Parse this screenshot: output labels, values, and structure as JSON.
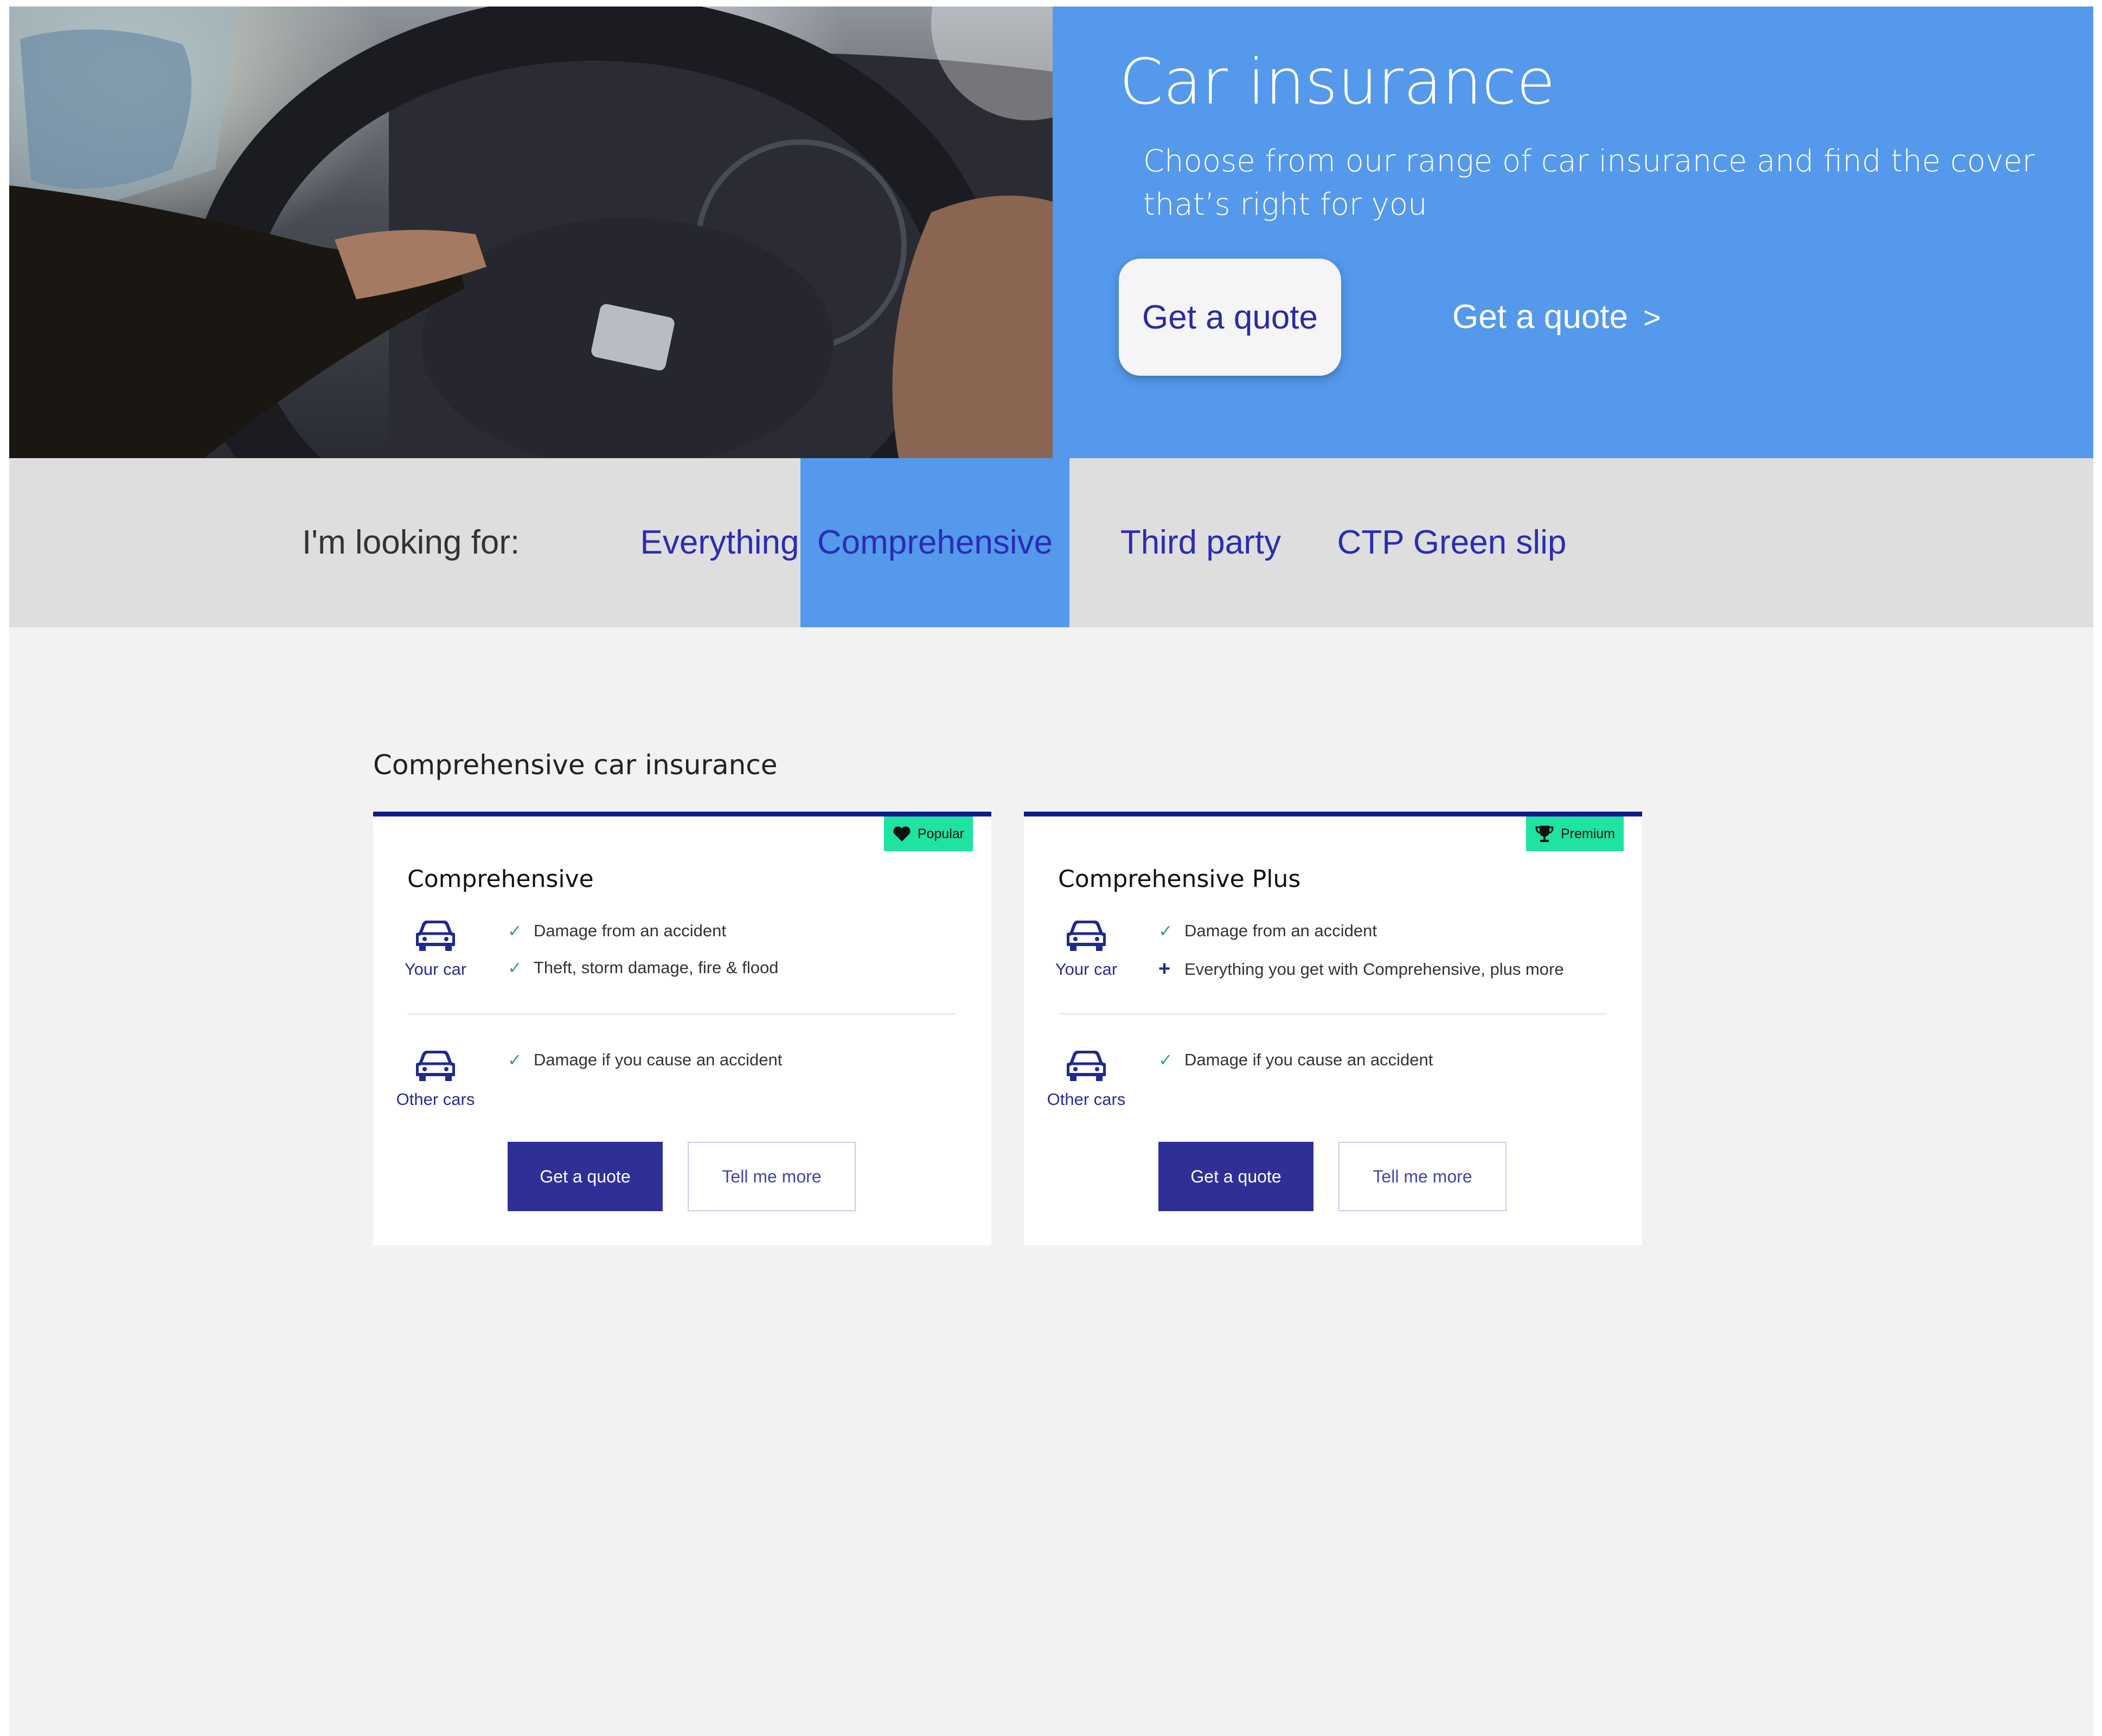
{
  "hero": {
    "title": "Car insurance",
    "subtitle": "Choose from our range of car insurance and find the cover that’s right for you",
    "quote_button": "Get a quote",
    "quote_link": "Get a quote",
    "quote_link_chevron": ">",
    "image_icon": "car-steering-wheel-photo"
  },
  "filter": {
    "label": "I'm looking for:",
    "tabs": [
      {
        "label": "Everything",
        "active": false
      },
      {
        "label": "Comprehensive",
        "active": true
      },
      {
        "label": "Third party",
        "active": false
      },
      {
        "label": "CTP Green slip",
        "active": false
      }
    ]
  },
  "section": {
    "title": "Comprehensive car insurance"
  },
  "cards": [
    {
      "badge": {
        "label": "Popular",
        "icon": "heart-icon"
      },
      "title": "Comprehensive",
      "your_car": {
        "label": "Your car",
        "features": [
          {
            "mark": "check",
            "text": "Damage from an accident"
          },
          {
            "mark": "check",
            "text": "Theft, storm damage, fire & flood"
          }
        ]
      },
      "other_cars": {
        "label": "Other cars",
        "features": [
          {
            "mark": "check",
            "text": "Damage if you cause an accident"
          }
        ]
      },
      "quote_button": "Get a quote",
      "more_button": "Tell me more"
    },
    {
      "badge": {
        "label": "Premium",
        "icon": "trophy-icon"
      },
      "title": "Comprehensive Plus",
      "your_car": {
        "label": "Your car",
        "features": [
          {
            "mark": "check",
            "text": "Damage from an accident"
          },
          {
            "mark": "plus",
            "text": "Everything you get with Comprehensive, plus more"
          }
        ]
      },
      "other_cars": {
        "label": "Other cars",
        "features": [
          {
            "mark": "check",
            "text": "Damage if you cause an accident"
          }
        ]
      },
      "quote_button": "Get a quote",
      "more_button": "Tell me more"
    }
  ],
  "colors": {
    "hero_panel": "#5499ec",
    "active_tab": "#5499ec",
    "filter_bar": "#dedede",
    "tab_text": "#2b2cb3",
    "card_top_border": "#131a8c",
    "badge": "#1ee3a2",
    "primary_button": "#2f3096",
    "check": "#3aa86b",
    "page_background": "#f2f2f2"
  }
}
